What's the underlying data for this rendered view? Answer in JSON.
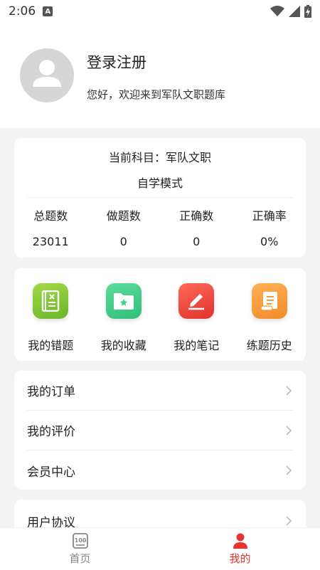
{
  "status": {
    "time": "2:06",
    "notify_badge": "A"
  },
  "header": {
    "login_label": "登录注册",
    "welcome": "您好，欢迎来到军队文职题库"
  },
  "subject": {
    "current": "当前科目：军队文职",
    "mode": "自学模式",
    "stats": [
      {
        "label": "总题数",
        "value": "23011"
      },
      {
        "label": "做题数",
        "value": "0"
      },
      {
        "label": "正确数",
        "value": "0"
      },
      {
        "label": "正确率",
        "value": "0%"
      }
    ]
  },
  "tools": [
    {
      "label": "我的错题",
      "icon": "wrong-book-icon",
      "color": "#8cc63f"
    },
    {
      "label": "我的收藏",
      "icon": "star-folder-icon",
      "color": "#3fcf8e"
    },
    {
      "label": "我的笔记",
      "icon": "pen-note-icon",
      "color": "#f04a3f"
    },
    {
      "label": "练题历史",
      "icon": "history-scroll-icon",
      "color": "#f59a38"
    }
  ],
  "menu": [
    {
      "label": "我的订单"
    },
    {
      "label": "我的评价"
    },
    {
      "label": "会员中心"
    }
  ],
  "menu2": {
    "label": "用户协议"
  },
  "tabs": [
    {
      "label": "首页",
      "icon": "home-100-icon",
      "color": "#888888"
    },
    {
      "label": "我的",
      "icon": "user-icon",
      "color": "#e8322b"
    }
  ]
}
